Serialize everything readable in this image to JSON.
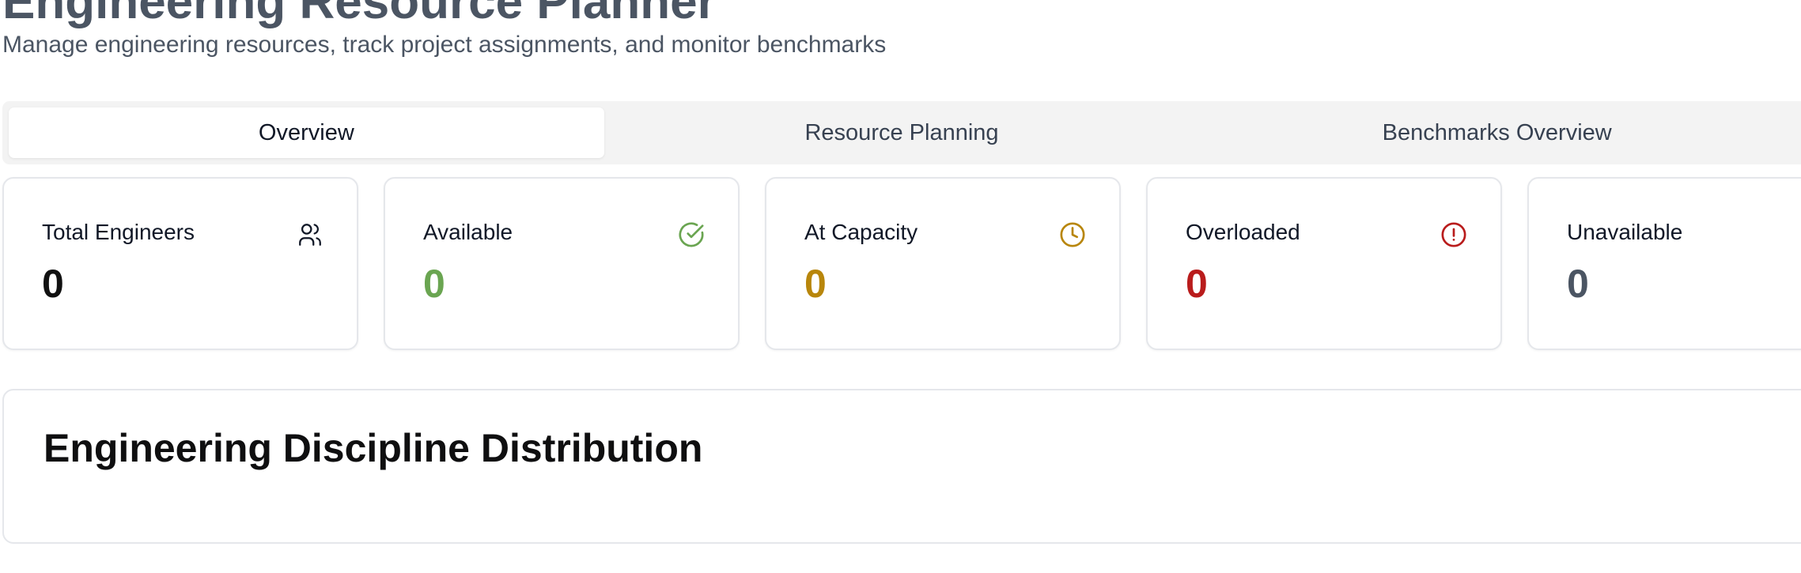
{
  "header": {
    "title": "Engineering Resource Planner",
    "subtitle": "Manage engineering resources, track project assignments, and monitor benchmarks"
  },
  "tabs": [
    {
      "label": "Overview",
      "active": true
    },
    {
      "label": "Resource Planning",
      "active": false
    },
    {
      "label": "Benchmarks Overview",
      "active": false
    }
  ],
  "stats": [
    {
      "label": "Total Engineers",
      "value": "0",
      "icon": "users-icon",
      "color": "#111111"
    },
    {
      "label": "Available",
      "value": "0",
      "icon": "check-circle-icon",
      "color": "#6aa551"
    },
    {
      "label": "At Capacity",
      "value": "0",
      "icon": "clock-icon",
      "color": "#b8860b"
    },
    {
      "label": "Overloaded",
      "value": "0",
      "icon": "alert-circle-icon",
      "color": "#b91c1c"
    },
    {
      "label": "Unavailable",
      "value": "0",
      "icon": "",
      "color": "#4b5563"
    }
  ],
  "distribution": {
    "title": "Engineering Discipline Distribution"
  }
}
